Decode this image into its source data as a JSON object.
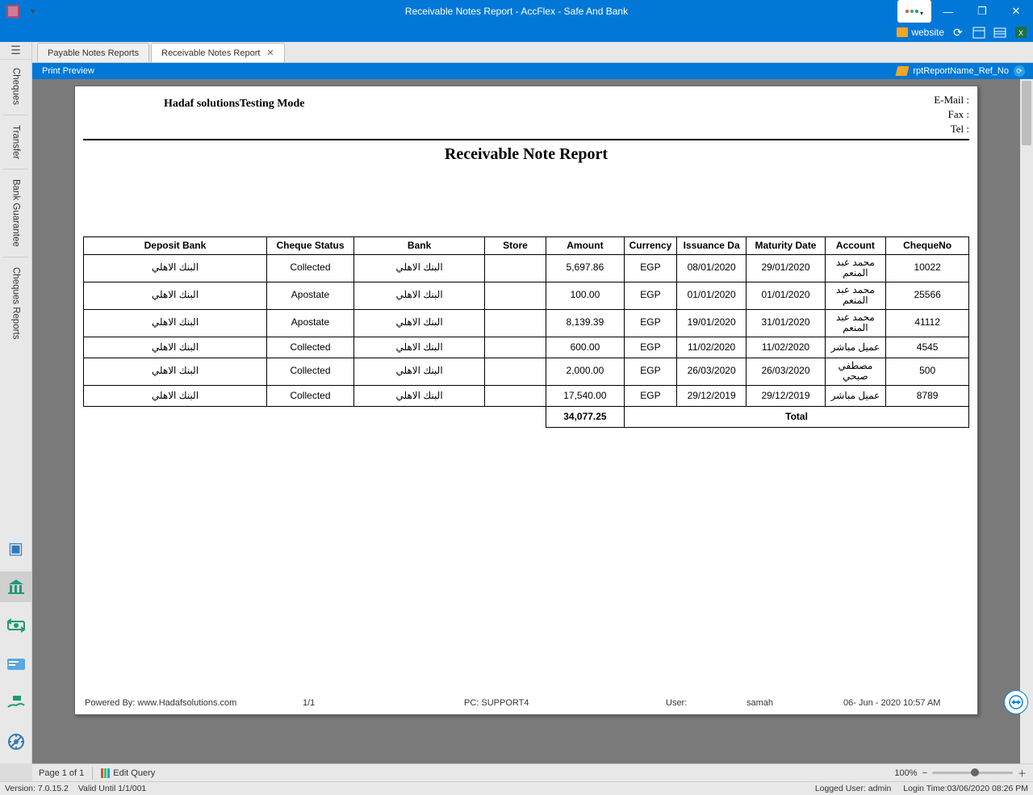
{
  "window": {
    "title": "Receivable Notes Report - AccFlex - Safe And Bank"
  },
  "topbar": {
    "website": "website"
  },
  "tabs": [
    {
      "label": "Payable Notes Reports",
      "closable": false
    },
    {
      "label": "Receivable Notes Report",
      "closable": true
    }
  ],
  "bluebar": {
    "left": "Print Preview",
    "right": "rptReportName_Ref_No"
  },
  "sidebar": {
    "vtabs": [
      "Cheques",
      "Transfer",
      "Bank Guarantee",
      "Cheques Reports"
    ]
  },
  "report": {
    "company": "Hadaf solutionsTesting Mode",
    "contact": {
      "email": "E-Mail :",
      "fax": "Fax :",
      "tel": "Tel :"
    },
    "title": "Receivable Note Report",
    "columns": [
      "Deposit Bank",
      "Cheque Status",
      "Bank",
      "Store",
      "Amount",
      "Currency",
      "Issuance Da",
      "Maturity Date",
      "Account",
      "ChequeNo"
    ],
    "rows": [
      {
        "deposit": "البنك الاهلي",
        "status": "Collected",
        "bank": "البنك الاهلي",
        "store": "",
        "amount": "5,697.86",
        "currency": "EGP",
        "issuance": "08/01/2020",
        "maturity": "29/01/2020",
        "account": "محمد عبد المنعم",
        "cheque": "10022",
        "tall": true
      },
      {
        "deposit": "البنك الاهلي",
        "status": "Apostate",
        "bank": "البنك الاهلي",
        "store": "",
        "amount": "100.00",
        "currency": "EGP",
        "issuance": "01/01/2020",
        "maturity": "01/01/2020",
        "account": "محمد عبد المنعم",
        "cheque": "25566",
        "tall": true
      },
      {
        "deposit": "البنك الاهلي",
        "status": "Apostate",
        "bank": "البنك الاهلي",
        "store": "",
        "amount": "8,139.39",
        "currency": "EGP",
        "issuance": "19/01/2020",
        "maturity": "31/01/2020",
        "account": "محمد عبد المنعم",
        "cheque": "41112",
        "tall": true
      },
      {
        "deposit": "البنك الاهلي",
        "status": "Collected",
        "bank": "البنك الاهلي",
        "store": "",
        "amount": "600.00",
        "currency": "EGP",
        "issuance": "11/02/2020",
        "maturity": "11/02/2020",
        "account": "عميل مباشر",
        "cheque": "4545",
        "tall": false
      },
      {
        "deposit": "البنك الاهلي",
        "status": "Collected",
        "bank": "البنك الاهلي",
        "store": "",
        "amount": "2,000.00",
        "currency": "EGP",
        "issuance": "26/03/2020",
        "maturity": "26/03/2020",
        "account": "مصطفي صبحي",
        "cheque": "500",
        "tall": true
      },
      {
        "deposit": "البنك الاهلي",
        "status": "Collected",
        "bank": "البنك الاهلي",
        "store": "",
        "amount": "17,540.00",
        "currency": "EGP",
        "issuance": "29/12/2019",
        "maturity": "29/12/2019",
        "account": "عميل مباشر",
        "cheque": "8789",
        "tall": false
      }
    ],
    "total_label": "Total",
    "total_amount": "34,077.25",
    "footer": {
      "powered": "Powered By: www.Hadafsolutions.com",
      "page": "1/1",
      "pc": "PC: SUPPORT4",
      "user_label": "User:",
      "user": "samah",
      "date": "06- Jun - 2020 10:57 AM"
    }
  },
  "pager": {
    "page": "Page 1 of 1",
    "edit": "Edit Query",
    "zoom": "100%"
  },
  "status": {
    "version": "Version: 7.0.15.2",
    "valid": "Valid Until  1/1/001",
    "user": "Logged User: admin",
    "time": "Login Time:03/06/2020 08:26 PM"
  }
}
